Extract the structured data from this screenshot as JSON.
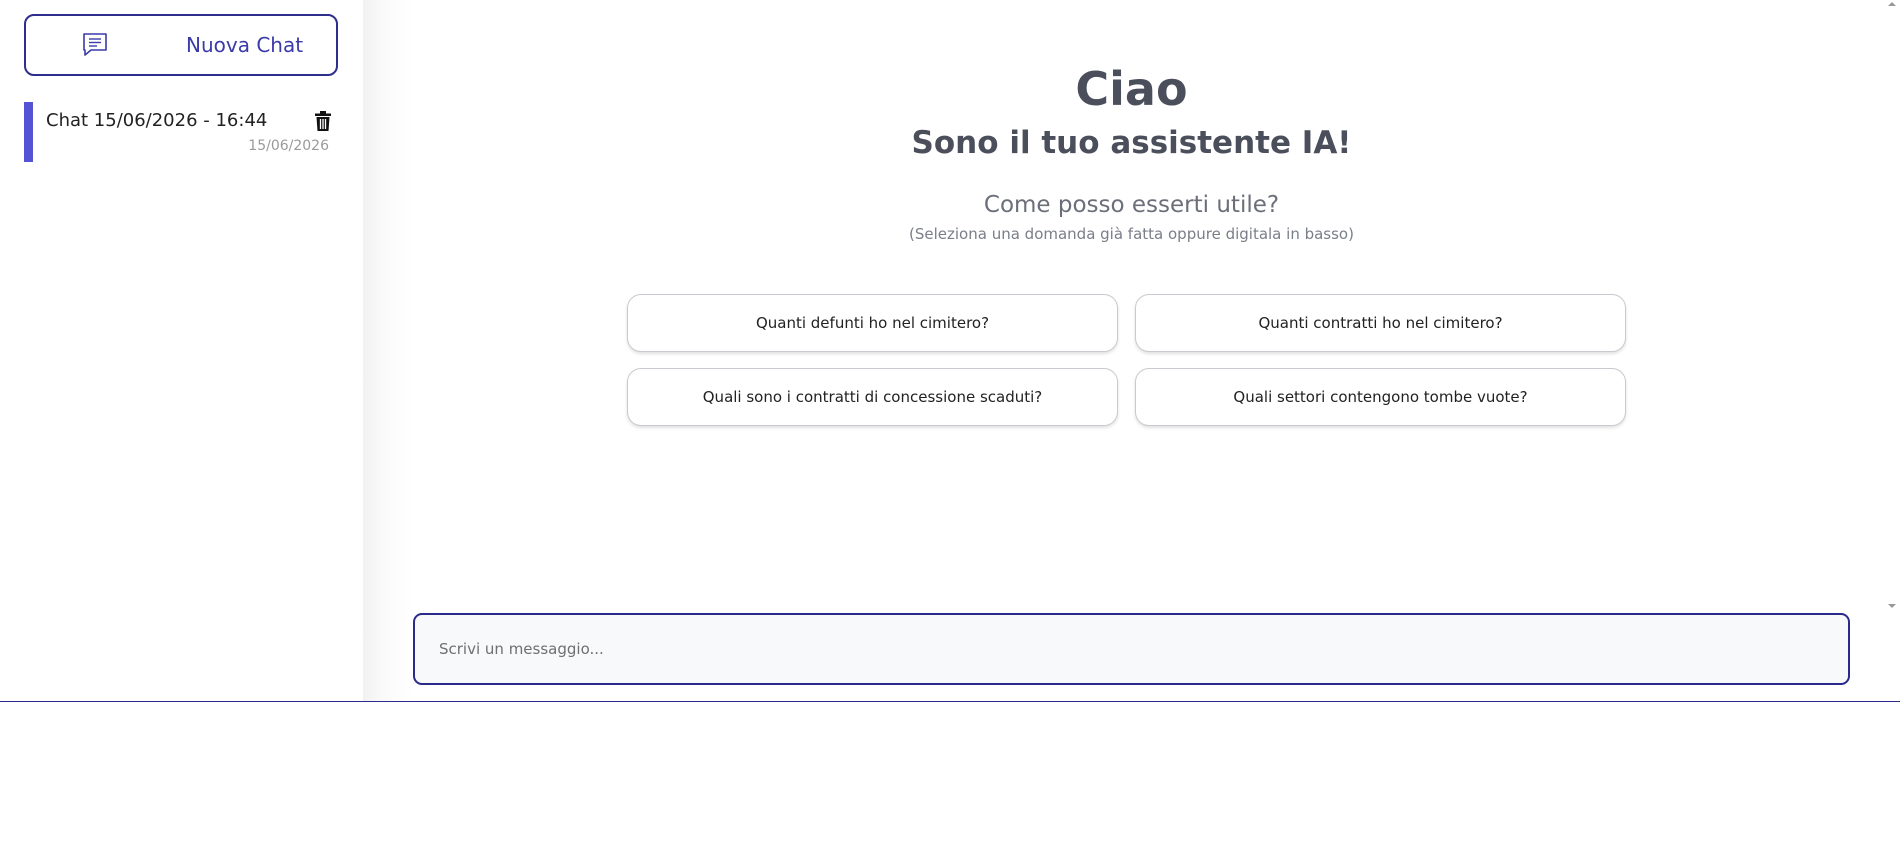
{
  "sidebar": {
    "new_chat_label": "Nuova Chat",
    "new_chat_icon": "chat-bubble-icon",
    "chats": [
      {
        "title": "Chat 15/06/2026 - 16:44",
        "date": "15/06/2026",
        "delete_icon": "trash-icon"
      }
    ]
  },
  "main": {
    "greeting": "Ciao",
    "subtitle": "Sono il tuo assistente IA!",
    "question": "Come posso esserti utile?",
    "hint": "(Seleziona una domanda già fatta oppure digitala in basso)",
    "suggestions": [
      "Quanti defunti ho nel cimitero?",
      "Quanti contratti ho nel cimitero?",
      "Quali sono i contratti di concessione scaduti?",
      "Quali settori contengono tombe vuote?"
    ]
  },
  "input": {
    "placeholder": "Scrivi un messaggio..."
  },
  "colors": {
    "accent": "#2e2e8c",
    "chat_marker": "#5353d3",
    "heading": "#4b4f5c"
  }
}
